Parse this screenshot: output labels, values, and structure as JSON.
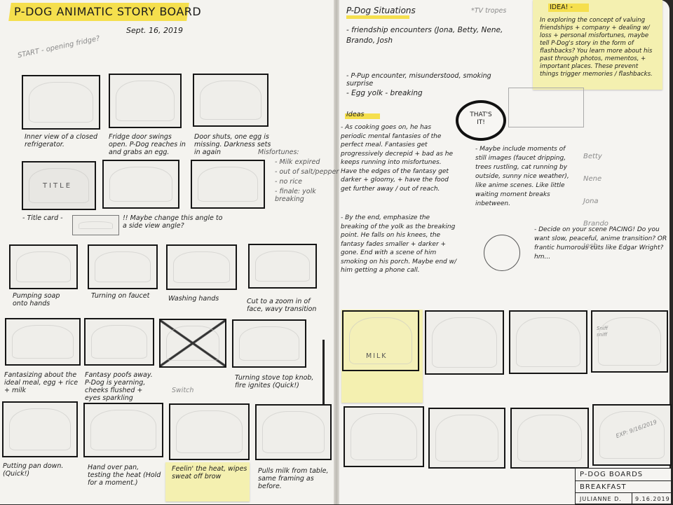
{
  "left_page": {
    "title": "P-DOG ANIMATIC STORY BOARD",
    "date": "Sept. 16, 2019",
    "start_note": "START - opening fridge?",
    "row1": [
      "Inner view of a closed refrigerator.",
      "Fridge door swings open. P-Dog reaches in and grabs an egg.",
      "Door shuts, one egg is missing. Darkness sets in again"
    ],
    "title_panel_text": "TITLE",
    "title_card": "- Title card -",
    "angle_note": "!! Maybe change this angle to a side view angle?",
    "misfortunes": {
      "heading": "Misfortunes:",
      "items": [
        "- Milk expired",
        "- out of salt/pepper",
        "- no rice",
        "- finale: yolk breaking"
      ]
    },
    "row3": [
      "Pumping soap onto hands",
      "Turning on faucet",
      "Washing hands",
      "Cut to a zoom in of face, wavy transition"
    ],
    "row4": [
      "Fantasizing about the ideal meal, egg + rice + milk",
      "Fantasy poofs away. P-Dog is yearning, cheeks flushed + eyes sparkling",
      "",
      "Turning stove top knob, fire ignites (Quick!)"
    ],
    "switch_note": "Switch",
    "row5": [
      "Putting pan down. (Quick!)",
      "Hand over pan, testing the heat (Hold for a moment.)",
      "Feelin' the heat, wipes sweat off brow",
      "Pulls milk from table, same framing as before."
    ]
  },
  "right_page": {
    "situations_title": "P-Dog Situations",
    "tv_tropes": "*TV tropes",
    "situations": [
      "- friendship encounters (Jona, Betty, Nene, Brando, Josh",
      "- P-Pup encounter, misunderstood, smoking surprise",
      "- Egg yolk - breaking"
    ],
    "bubble_text": "THAT'S IT!",
    "idea_title": "IDEA! -",
    "idea_text": "In exploring the concept of valuing friendships + company + dealing w/ loss + personal misfortunes, maybe tell P-Dog's story in the form of flashbacks? You learn more about his past through photos, mementos, + important places. These prevent things trigger memories / flashbacks.",
    "ideas_heading": "Ideas",
    "ideas": [
      "- As cooking goes on, he has periodic mental fantasies of the perfect meal. Fantasies get progressively decrepid + bad as he keeps running into misfortunes. Have the edges of the fantasy get darker + gloomy, + have the food get further away / out of reach.",
      "- By the end, emphasize the breaking of the yolk as the breaking point. He falls on his knees, the fantasy fades smaller + darker + gone. End with a scene of him smoking on his porch. Maybe end w/ him getting a phone call."
    ],
    "still_images_note": "- Maybe include moments of still images (faucet dripping, trees rustling, cat running by outside, sunny nice weather), like anime scenes. Like little waiting moment breaks inbetween.",
    "names": [
      "Betty",
      "Nene",
      "Jona",
      "Brando",
      "Josh"
    ],
    "pacing_note": "- Decide on your scene PACING! Do you want slow, peaceful, anime transition? OR frantic humorous cuts like Edgar Wright? hm...",
    "panel_texts": {
      "milk": "MILK",
      "sniff": "Sniff sniff",
      "exp": "EXP: 9/16/2019"
    },
    "title_block": {
      "line1": "P-DOG BOARDS",
      "line2": "BREAKFAST",
      "author": "JULIANNE D.",
      "date": "9.16.2019"
    }
  },
  "colors": {
    "highlight": "#f5df4d",
    "sticky": "#f4f0b0",
    "paper": "#f4f3ef",
    "ink": "#151515"
  }
}
